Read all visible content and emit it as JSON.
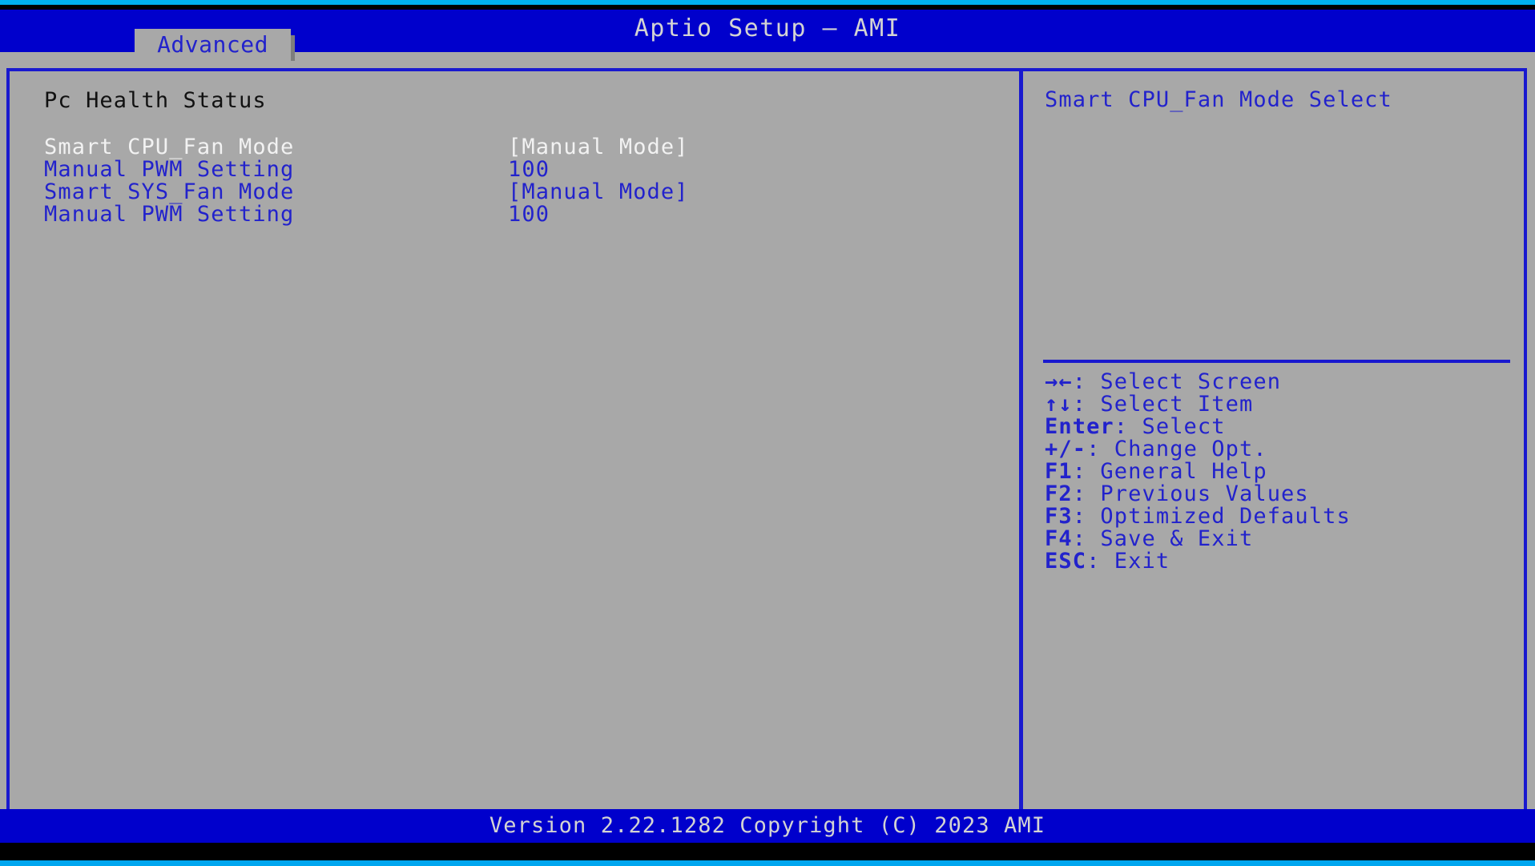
{
  "window": {
    "title": "Aptio Setup – AMI"
  },
  "tabs": [
    {
      "label": "Advanced",
      "active": true
    }
  ],
  "main": {
    "section_title": "Pc Health Status",
    "rows": [
      {
        "label": "Smart CPU_Fan Mode",
        "value": "[Manual Mode]",
        "selected": true
      },
      {
        "label": "Manual PWM Setting",
        "value": "100",
        "selected": false
      },
      {
        "label": "Smart SYS_Fan Mode",
        "value": "[Manual Mode]",
        "selected": false
      },
      {
        "label": "Manual PWM Setting",
        "value": "100",
        "selected": false
      }
    ]
  },
  "help": {
    "description": "Smart CPU_Fan Mode Select",
    "legend": [
      {
        "key": "→←",
        "text": ": Select Screen"
      },
      {
        "key": "↑↓",
        "text": ": Select Item"
      },
      {
        "key": "Enter",
        "text": ": Select"
      },
      {
        "key": "+/-",
        "text": ": Change Opt."
      },
      {
        "key": "F1",
        "text": ": General Help"
      },
      {
        "key": "F2",
        "text": ": Previous Values"
      },
      {
        "key": "F3",
        "text": ": Optimized Defaults"
      },
      {
        "key": "F4",
        "text": ": Save & Exit"
      },
      {
        "key": "ESC",
        "text": ": Exit"
      }
    ]
  },
  "footer": {
    "version_text": "Version 2.22.1282 Copyright (C) 2023 AMI"
  },
  "colors": {
    "header_blue": "#0000cc",
    "panel_gray": "#a8a8a8",
    "border_blue": "#1919cf",
    "text_blue": "#2222cc",
    "text_white": "#f2f2f2",
    "text_black": "#111111",
    "edge_cyan": "#00b0f0"
  }
}
